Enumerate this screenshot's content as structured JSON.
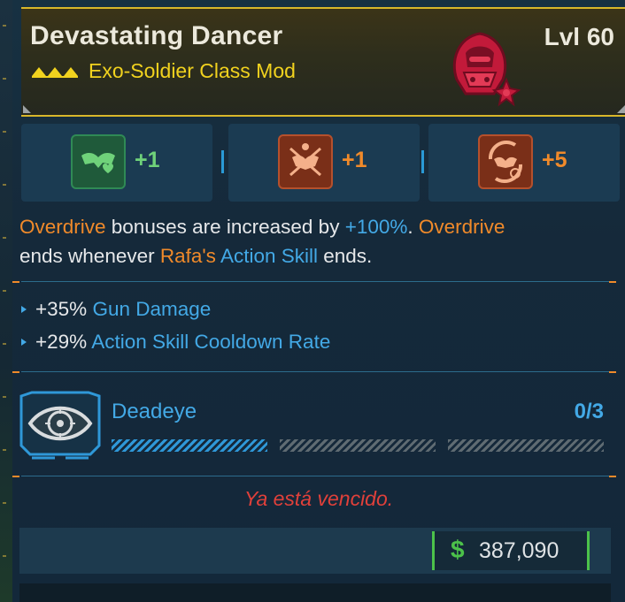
{
  "item": {
    "name": "Devastating Dancer",
    "level": "Lvl 60",
    "type": "Exo-Soldier Class Mod",
    "rarity_color": "#f1d21e",
    "emblem_icon": "exo-soldier-hood-emblem-icon"
  },
  "perks": [
    {
      "icon": "mask-heart-perk-icon",
      "value": "+1",
      "color": "#6fd27a"
    },
    {
      "icon": "crossed-blades-mask-perk-icon",
      "value": "+1",
      "color": "#f08a2a"
    },
    {
      "icon": "spinning-blades-mask-perk-icon",
      "value": "+5",
      "color": "#f08a2a"
    }
  ],
  "description": {
    "s1_keyword": "Overdrive",
    "s1_text": " bonuses are increased by ",
    "s1_value": "+100%",
    "s1_end": ". ",
    "s2_keyword": "Overdrive",
    "s2_text": " ends whenever ",
    "s2_name": "Rafa's",
    "s2_space": " ",
    "s2_skill": "Action Skill",
    "s2_end": " ends."
  },
  "stats": [
    {
      "value": "+35%",
      "label": "Gun Damage"
    },
    {
      "value": "+29%",
      "label": "Action Skill Cooldown Rate"
    }
  ],
  "skill": {
    "icon": "eye-target-skill-icon",
    "name": "Deadeye",
    "rank": "0/3",
    "rank_current": 0,
    "rank_max": 3
  },
  "status_message": "Ya está vencido.",
  "price": {
    "currency_symbol": "$",
    "value": "387,090"
  },
  "colors": {
    "keyword_orange": "#f08a2a",
    "highlight_blue": "#43a9e6",
    "expired_red": "#e0403a",
    "money_green": "#4cc24a"
  }
}
